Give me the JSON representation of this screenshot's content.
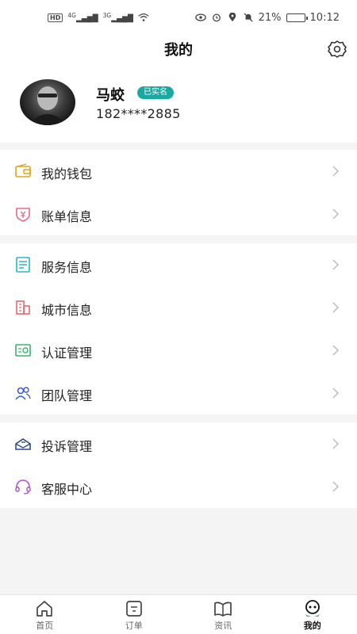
{
  "status_bar": {
    "network_badge": "HD",
    "signal1": "4G",
    "signal2": "3G",
    "battery": "21%",
    "time": "10:12"
  },
  "header": {
    "title": "我的",
    "settings_icon": "gear-icon"
  },
  "profile": {
    "name": "马蛟",
    "verified_badge": "已实名",
    "phone": "182****2885"
  },
  "menu": {
    "group1": [
      {
        "label": "我的钱包",
        "icon": "wallet-icon",
        "color": "#e0a21b"
      },
      {
        "label": "账单信息",
        "icon": "bill-shield-icon",
        "color": "#e46b86"
      }
    ],
    "group2": [
      {
        "label": "服务信息",
        "icon": "receipt-icon",
        "color": "#2ab5d6"
      },
      {
        "label": "城市信息",
        "icon": "building-icon",
        "color": "#e46b6b"
      },
      {
        "label": "认证管理",
        "icon": "certificate-icon",
        "color": "#3bb36a"
      },
      {
        "label": "团队管理",
        "icon": "team-icon",
        "color": "#3a5bd0"
      }
    ],
    "group3": [
      {
        "label": "投诉管理",
        "icon": "complaint-envelope-icon",
        "color": "#2b4a8f"
      },
      {
        "label": "客服中心",
        "icon": "headset-icon",
        "color": "#b24fd6"
      }
    ]
  },
  "tabbar": [
    {
      "label": "首页",
      "icon": "home-icon"
    },
    {
      "label": "订单",
      "icon": "order-icon"
    },
    {
      "label": "资讯",
      "icon": "news-book-icon"
    },
    {
      "label": "我的",
      "icon": "profile-icon",
      "active": true
    }
  ]
}
